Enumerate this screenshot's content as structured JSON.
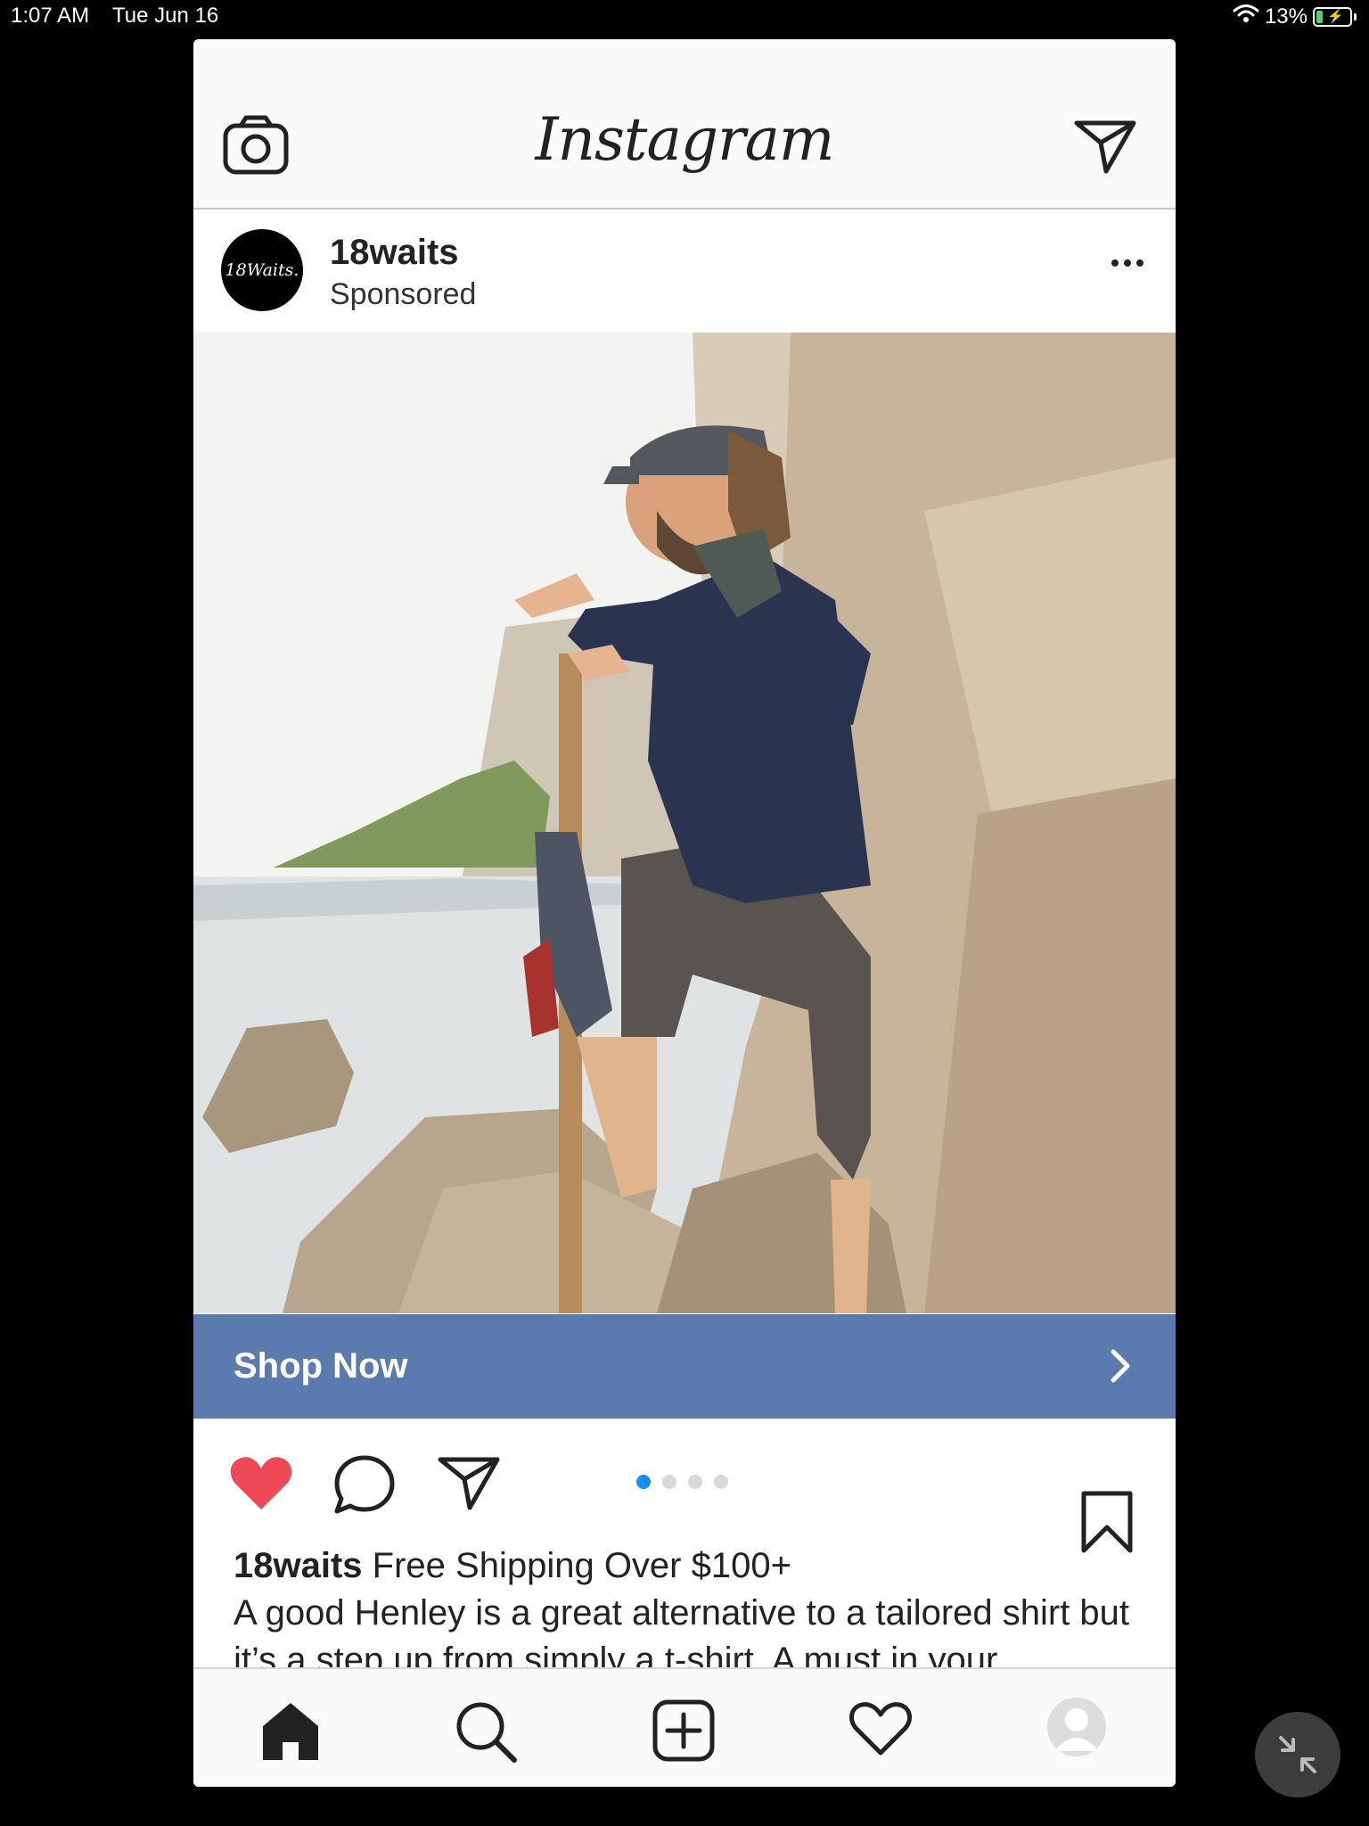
{
  "status_bar": {
    "time": "1:07 AM",
    "date": "Tue Jun 16",
    "battery": "13%",
    "battery_level": 0.13
  },
  "header": {
    "logo": "Instagram",
    "left_icon": "camera-icon",
    "right_icon": "send-icon"
  },
  "post": {
    "avatar_text": "18Waits.",
    "username": "18waits",
    "subtitle": "Sponsored",
    "more_icon": "more-icon",
    "cta_label": "Shop Now",
    "carousel": {
      "count": 4,
      "active_index": 0
    },
    "liked": true,
    "caption_user": "18waits",
    "caption_headline": "Free Shipping Over $100+",
    "caption_body": "A good Henley is a great alternative to a tailored shirt but it’s a step up from simply a t-shirt. A must in your"
  },
  "tabbar": {
    "items": [
      "home-icon",
      "search-icon",
      "new-post-icon",
      "activity-icon",
      "profile-icon"
    ]
  },
  "colors": {
    "cta_background": "#5b7aae",
    "like_red": "#ed4956",
    "carousel_active": "#1b8ff0"
  }
}
